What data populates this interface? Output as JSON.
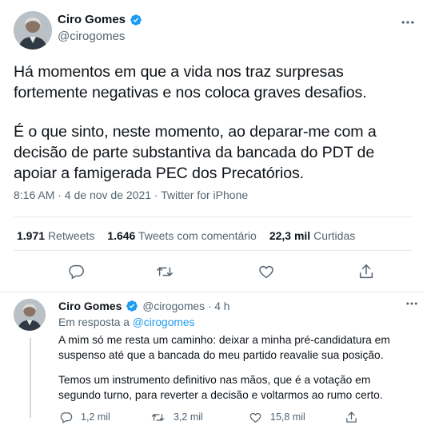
{
  "main_tweet": {
    "author_name": "Ciro Gomes",
    "handle": "@cirogomes",
    "paragraph_1": "Há momentos em que a vida nos traz surpresas fortemente negativas e nos coloca graves desafios.",
    "paragraph_2": "É o que sinto, neste momento, ao deparar-me com a decisão de parte substantiva da bancada do PDT de apoiar a famigerada PEC dos Precatórios.",
    "meta": "8:16 AM · 4 de nov de 2021 · Twitter for iPhone",
    "stats": {
      "retweets_count": "1.971",
      "retweets_label": "Retweets",
      "quotes_count": "1.646",
      "quotes_label": "Tweets com comentário",
      "likes_count": "22,3 mil",
      "likes_label": "Curtidas"
    },
    "icons": [
      "reply-icon",
      "retweet-icon",
      "like-icon",
      "share-icon"
    ]
  },
  "reply_tweet": {
    "author_name": "Ciro Gomes",
    "handle_time": "@cirogomes · 4 h",
    "reply_to_prefix": "Em resposta a",
    "reply_to_mention": "@cirogomes",
    "paragraph_1": "A mim só me resta um caminho: deixar a minha pré-candidatura em suspenso até que a bancada do meu partido reavalie sua posição.",
    "paragraph_2": "Temos um instrumento definitivo nas mãos, que é a votação em segundo turno, para  reverter a decisão e voltarmos ao rumo certo.",
    "replies": "1,2 mil",
    "retweets": "3,2 mil",
    "likes": "15,8 mil",
    "more": "···"
  },
  "colors": {
    "verified": "#1d9bf0",
    "link": "#1d9bf0",
    "secondary_text": "#536471",
    "divider": "#e6e9eb"
  }
}
